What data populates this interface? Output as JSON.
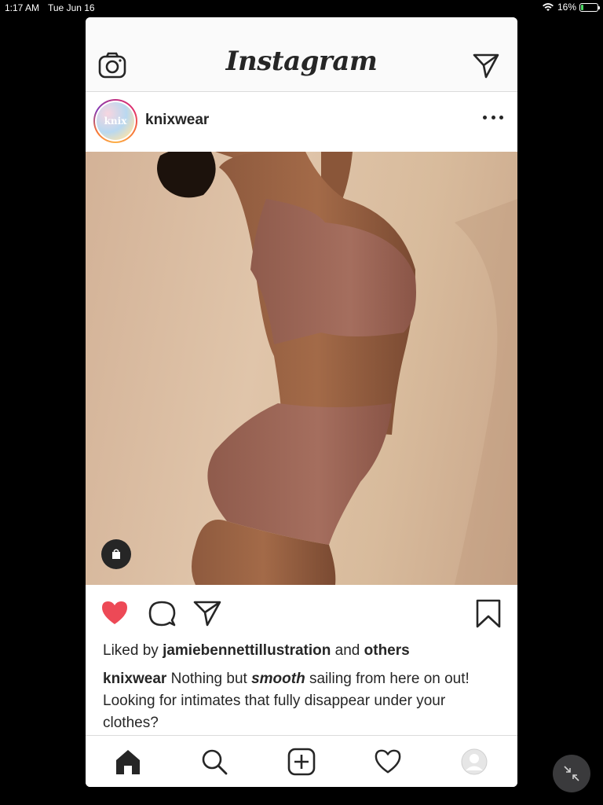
{
  "status_bar": {
    "time": "1:17 AM",
    "date": "Tue Jun 16",
    "battery": "16%",
    "battery_level": 0.16
  },
  "header": {
    "title": "Instagram"
  },
  "post": {
    "username": "knixwear",
    "avatar_text": "knix",
    "liked_by_prefix": "Liked by",
    "liked_by_user": "jamiebennettillustration",
    "liked_by_and": "and",
    "liked_by_others": "others",
    "caption_user": "knixwear",
    "caption_part1": "Nothing but",
    "caption_emphasis": "smooth",
    "caption_part2": "sailing from here on out!",
    "caption_line2": "Looking for intimates that fully disappear under your clothes?"
  },
  "colors": {
    "like_red": "#ed4956",
    "text": "#262626",
    "battery_green": "#4cd964"
  },
  "icons": [
    "camera-icon",
    "direct-message-icon",
    "more-options-icon",
    "shopping-bag-icon",
    "heart-filled-icon",
    "comment-icon",
    "share-icon",
    "bookmark-icon",
    "home-icon",
    "search-icon",
    "add-post-icon",
    "activity-heart-icon",
    "profile-icon",
    "minimize-icon"
  ]
}
